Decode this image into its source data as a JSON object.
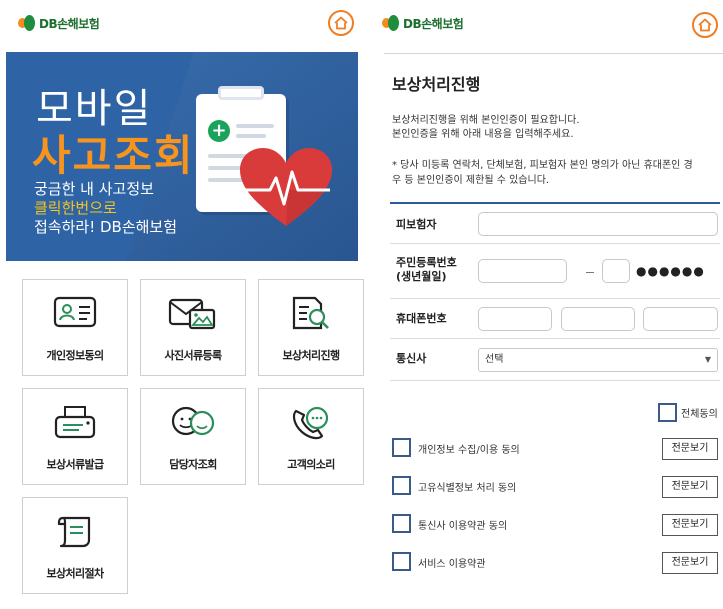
{
  "left": {
    "logo_text": "DB손해보험",
    "banner": {
      "title_line1": "모바일",
      "title_line2": "사고조회",
      "line1": "궁금한 내 사고정보",
      "line2": "클릭한번으로",
      "line3": "접속하라! DB손해보험",
      "colors": {
        "bg": "#2e63a6",
        "accent": "#f7941d",
        "highlight": "#f7c51d"
      }
    },
    "menu": [
      {
        "label": "개인정보동의",
        "icon": "id-card-icon"
      },
      {
        "label": "사진서류등록",
        "icon": "photo-envelope-icon"
      },
      {
        "label": "보상처리진행",
        "icon": "document-search-icon"
      },
      {
        "label": "보상서류발급",
        "icon": "printer-icon"
      },
      {
        "label": "담당자조회",
        "icon": "contact-persons-icon"
      },
      {
        "label": "고객의소리",
        "icon": "chat-phone-icon"
      },
      {
        "label": "보상처리절차",
        "icon": "scroll-document-icon"
      }
    ]
  },
  "right": {
    "logo_text": "DB손해보험",
    "title": "보상처리진행",
    "desc_line1": "보상처리진행을 위해 본인인증이 필요합니다.",
    "desc_line2": "본인인증을 위해 아래 내용을 입력해주세요.",
    "notice_line1": "* 당사 미등록 연락처, 단체보험, 피보험자 본인 명의가 아닌 휴대폰인 경",
    "notice_line2": "우 등 본인인증이 제한될 수 있습니다.",
    "form": {
      "insured_label": "피보험자",
      "rrn_label_1": "주민등록번호",
      "rrn_label_2": "(생년월일)",
      "rrn_dash": "–",
      "rrn_mask": "●●●●●●",
      "phone_label": "휴대폰번호",
      "carrier_label": "통신사",
      "carrier_value": "선택"
    },
    "consent": {
      "all_label": "전체동의",
      "items": [
        {
          "label": "개인정보 수집/이용 동의",
          "button": "전문보기"
        },
        {
          "label": "고유식별정보 처리 동의",
          "button": "전문보기"
        },
        {
          "label": "통신사 이용약관 동의",
          "button": "전문보기"
        },
        {
          "label": "서비스 이용약관",
          "button": "전문보기"
        }
      ]
    }
  }
}
